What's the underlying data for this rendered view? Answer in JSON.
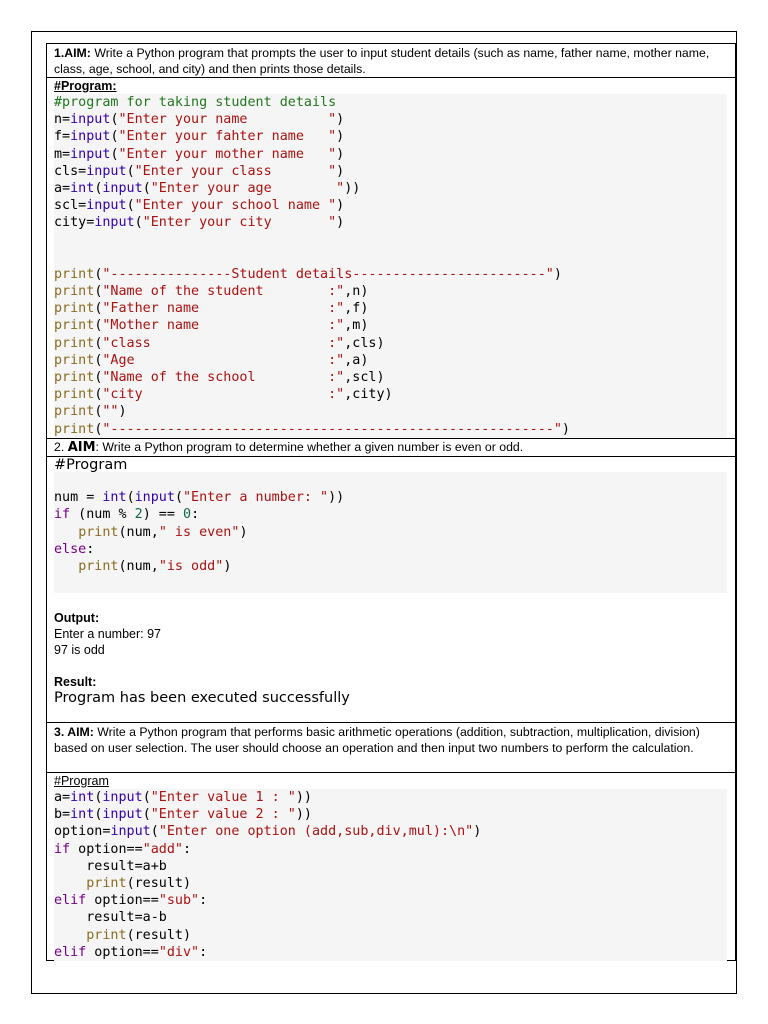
{
  "section1": {
    "aim_label": "1.AIM:",
    "aim_text": " Write a Python program that prompts the user to input student details (such as name, father name, mother name, class, age, school, and city) and then prints those details.",
    "program_label": "#Program:",
    "code": [
      "#program for taking student details",
      "n=input(\"Enter your name          \")",
      "f=input(\"Enter your fahter name   \")",
      "m=input(\"Enter your mother name   \")",
      "cls=input(\"Enter your class       \")",
      "a=int(input(\"Enter your age        \"))",
      "scl=input(\"Enter your school name \")",
      "city=input(\"Enter your city       \")",
      "",
      "",
      "print(\"---------------Student details------------------------\")",
      "print(\"Name of the student        :\",n)",
      "print(\"Father name                :\",f)",
      "print(\"Mother name                :\",m)",
      "print(\"class                      :\",cls)",
      "print(\"Age                        :\",a)",
      "print(\"Name of the school         :\",scl)",
      "print(\"city                       :\",city)",
      "print(\"\")",
      "print(\"-------------------------------------------------------\")"
    ]
  },
  "section2": {
    "aim_num": "2. ",
    "aim_label": "AIM",
    "aim_text": ": Write a Python program to determine whether a given number is even or odd.",
    "program_label": "#Program",
    "code": [
      "",
      "num = int(input(\"Enter a number: \"))",
      "if (num % 2) == 0:",
      "   print(num,\" is even\")",
      "else:",
      "   print(num,\"is odd\")",
      "",
      ""
    ],
    "output_label": "Output:",
    "output_lines": [
      "Enter a number: 97",
      "97 is odd"
    ],
    "result_label": "Result:",
    "result_text": "Program has been executed successfully"
  },
  "section3": {
    "aim_label": "3. AIM:",
    "aim_text": " Write a Python program that performs basic arithmetic operations (addition, subtraction, multiplication, division) based on user selection. The user should choose an operation and then input two numbers to perform the calculation.",
    "program_label": "#Program",
    "code": [
      "a=int(input(\"Enter value 1 : \"))",
      "b=int(input(\"Enter value 2 : \"))",
      "option=input(\"Enter one option (add,sub,div,mul):\\n\")",
      "if option==\"add\":",
      "    result=a+b",
      "    print(result)",
      "elif option==\"sub\":",
      "    result=a-b",
      "    print(result)",
      "elif option==\"div\":"
    ]
  },
  "colors": {
    "keyword": "#770088",
    "builtin": "#3300aa",
    "string": "#aa1111",
    "print_fn": "#8a6d22",
    "number": "#116644",
    "comment": "#22761f",
    "code_background": "#f5f5f5"
  }
}
